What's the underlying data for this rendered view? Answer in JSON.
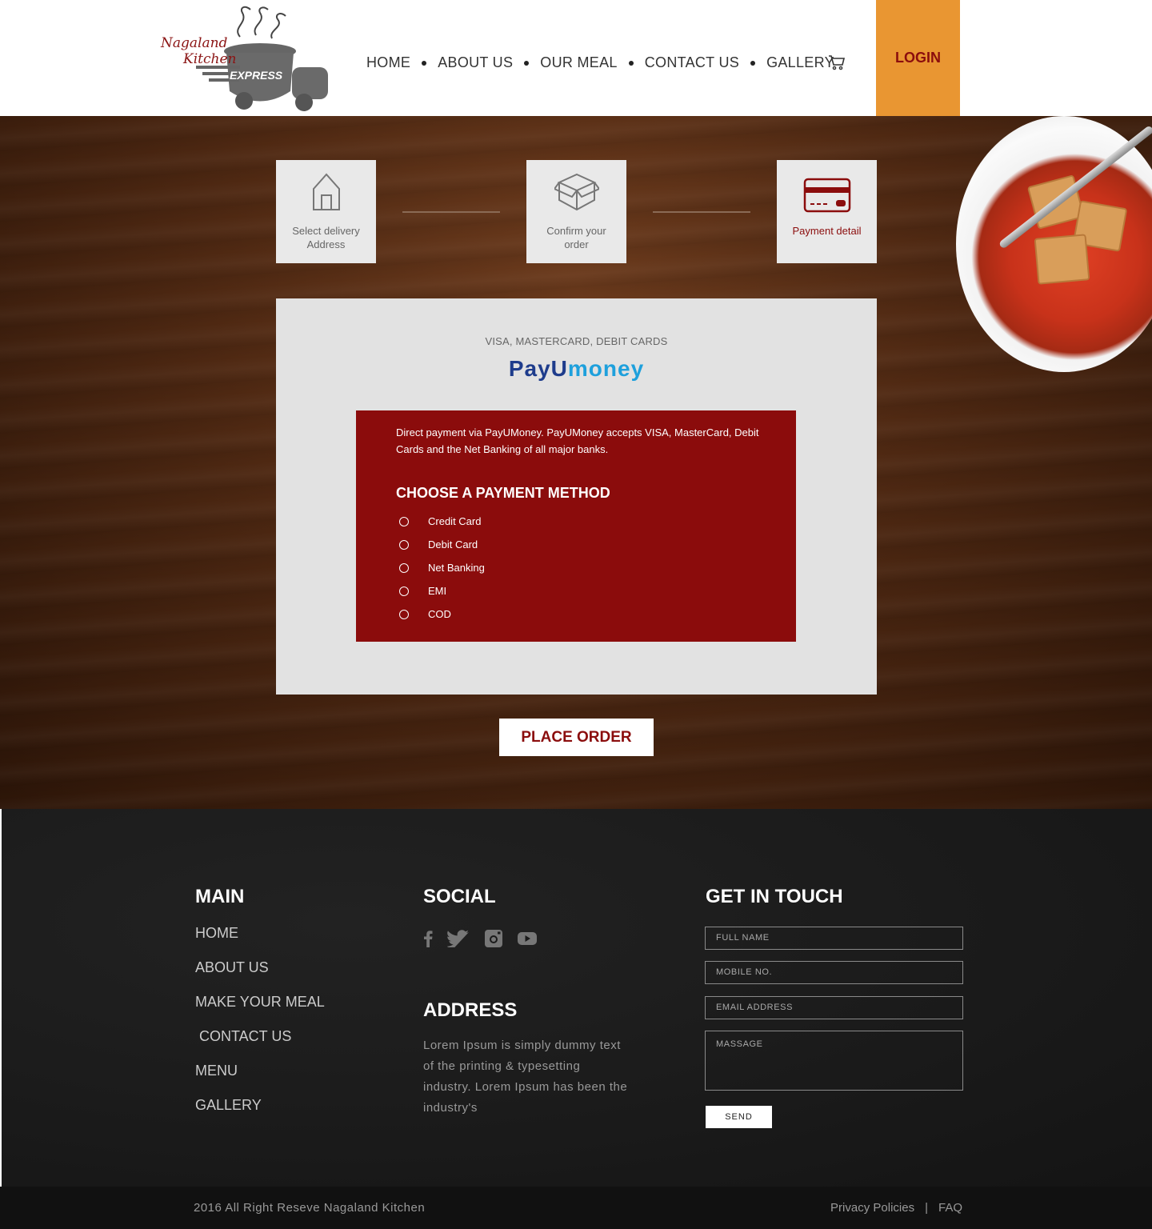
{
  "header": {
    "logo_text_line1": "Nagaland",
    "logo_text_line2": "Kitchen",
    "logo_text_badge": "EXPRESS",
    "nav": [
      "HOME",
      "ABOUT US",
      "OUR MEAL",
      "CONTACT US",
      "GALLERY"
    ],
    "login_label": "LOGIN"
  },
  "steps": [
    {
      "label_line1": "Select delivery",
      "label_line2": "Address",
      "icon": "house-icon"
    },
    {
      "label_line1": "Confirm your",
      "label_line2": "order",
      "icon": "box-icon"
    },
    {
      "label_line1": "Payment detail",
      "label_line2": "",
      "icon": "card-icon"
    }
  ],
  "payment": {
    "subtitle": "VISA, MASTERCARD, DEBIT CARDS",
    "brand_part1": "PayU",
    "brand_part2": "money",
    "description": "Direct payment via PayUMoney. PayUMoney accepts VISA, MasterCard, Debit Cards and the Net Banking of all major banks.",
    "method_title": "CHOOSE A PAYMENT METHOD",
    "methods": [
      "Credit Card",
      "Debit Card",
      "Net Banking",
      "EMI",
      "COD"
    ]
  },
  "place_order_label": "PLACE ORDER",
  "footer": {
    "main_title": "MAIN",
    "main_links": [
      "HOME",
      "ABOUT US",
      "MAKE YOUR MEAL",
      " CONTACT US",
      "MENU",
      "GALLERY"
    ],
    "social_title": "SOCIAL",
    "social_icons": [
      "facebook-icon",
      "twitter-icon",
      "instagram-icon",
      "youtube-icon"
    ],
    "address_title": "ADDRESS",
    "address_text": "Lorem Ipsum is simply dummy text of the printing & typesetting industry. Lorem Ipsum has been the industry's",
    "contact_title": "GET IN TOUCH",
    "fields": {
      "name": "FULL NAME",
      "mobile": "MOBILE NO.",
      "email": "EMAIL ADDRESS",
      "message": "MASSAGE"
    },
    "send_label": "SEND"
  },
  "bottom": {
    "copyright": "2016 All Right Reseve Nagaland Kitchen",
    "privacy": "Privacy Policies",
    "separator": "|",
    "faq": "FAQ"
  },
  "colors": {
    "accent_orange": "#e99632",
    "brand_red": "#8b0c0c",
    "footer_bg": "#1a1a1a"
  }
}
